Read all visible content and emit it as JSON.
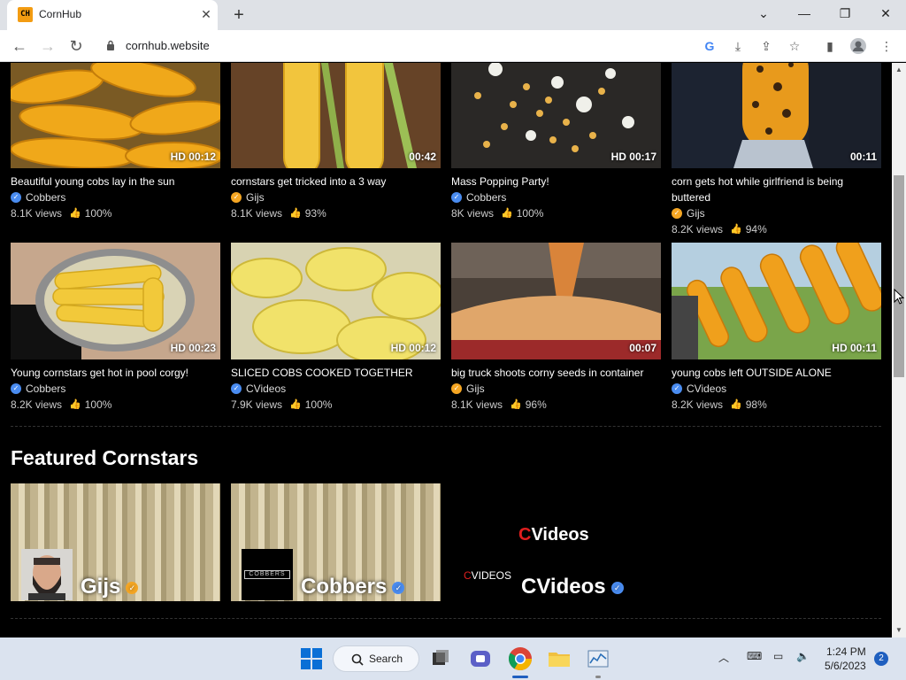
{
  "browser": {
    "tab_title": "CornHub",
    "favicon_text": "CH",
    "url": "cornhub.website"
  },
  "videos": [
    {
      "title": "Beautiful young cobs lay in the sun",
      "duration": "HD 00:12",
      "channel": "Cobbers",
      "badge": "blue",
      "views": "8.1K views",
      "rating": "100%"
    },
    {
      "title": "cornstars get tricked into a 3 way",
      "duration": "00:42",
      "channel": "Gijs",
      "badge": "gold",
      "views": "8.1K views",
      "rating": "93%"
    },
    {
      "title": "Mass Popping Party!",
      "duration": "HD 00:17",
      "channel": "Cobbers",
      "badge": "blue",
      "views": "8K views",
      "rating": "100%"
    },
    {
      "title": "corn gets hot while girlfriend is being buttered",
      "duration": "00:11",
      "channel": "Gijs",
      "badge": "gold",
      "views": "8.2K views",
      "rating": "94%"
    },
    {
      "title": "Young cornstars get hot in pool corgy!",
      "duration": "HD 00:23",
      "channel": "Cobbers",
      "badge": "blue",
      "views": "8.2K views",
      "rating": "100%"
    },
    {
      "title": "SLICED COBS COOKED TOGETHER",
      "duration": "HD 00:12",
      "channel": "CVideos",
      "badge": "blue",
      "views": "7.9K views",
      "rating": "100%"
    },
    {
      "title": "big truck shoots corny seeds in container",
      "duration": "00:07",
      "channel": "Gijs",
      "badge": "gold",
      "views": "8.1K views",
      "rating": "96%"
    },
    {
      "title": "young cobs left OUTSIDE ALONE",
      "duration": "HD 00:11",
      "channel": "CVideos",
      "badge": "blue",
      "views": "8.2K views",
      "rating": "98%"
    }
  ],
  "featured": {
    "title": "Featured Cornstars",
    "stars": [
      {
        "name": "Gijs",
        "badge": "gold"
      },
      {
        "name": "Cobbers",
        "badge": "blue",
        "logo_text": "COBBERS"
      },
      {
        "name": "CVideos",
        "badge": "blue",
        "logo_c": "C",
        "logo_rest": "Videos",
        "small_logo_c": "C",
        "small_logo_rest": "VIDEOS"
      }
    ]
  },
  "taskbar": {
    "search_label": "Search",
    "time": "1:24 PM",
    "date": "5/6/2023",
    "notification_count": "2"
  },
  "colors": {
    "verified_blue": "#4a8cf0",
    "verified_gold": "#f5a623",
    "logo_red": "#e01e1e"
  }
}
